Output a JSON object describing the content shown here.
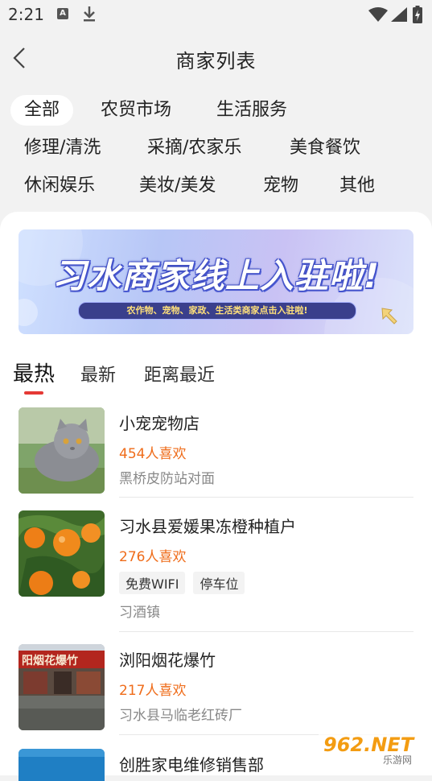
{
  "status_bar": {
    "time": "2:21",
    "a_badge": "A",
    "icons": [
      "download-icon",
      "wifi-icon",
      "signal-icon",
      "battery-icon"
    ]
  },
  "nav": {
    "title": "商家列表",
    "back_icon": "chevron-left-icon"
  },
  "categories": [
    {
      "label": "全部",
      "active": true
    },
    {
      "label": "农贸市场"
    },
    {
      "label": "生活服务"
    },
    {
      "label": "修理/清洗"
    },
    {
      "label": "采摘/农家乐"
    },
    {
      "label": "美食餐饮"
    },
    {
      "label": "休闲娱乐"
    },
    {
      "label": "美妆/美发"
    },
    {
      "label": "宠物"
    },
    {
      "label": "其他"
    }
  ],
  "banner": {
    "title": "习水商家线上入驻啦!",
    "subtitle": "农作物、宠物、家政、生活类商家点击入驻啦!"
  },
  "tabs": [
    {
      "label": "最热",
      "active": true
    },
    {
      "label": "最新"
    },
    {
      "label": "距离最近"
    }
  ],
  "stores": [
    {
      "name": "小宠宠物店",
      "likes": "454人喜欢",
      "tags": [],
      "address": "黑桥皮防站对面",
      "thumb": "cat-photo"
    },
    {
      "name": "习水县爱媛果冻橙种植户",
      "likes": "276人喜欢",
      "tags": [
        "免费WIFI",
        "停车位"
      ],
      "address": "习酒镇",
      "thumb": "orange-photo"
    },
    {
      "name": "浏阳烟花爆竹",
      "likes": "217人喜欢",
      "tags": [],
      "address": "习水县马临老红砖厂",
      "thumb": "shopfront-photo"
    },
    {
      "name": "创胜家电维修销售部",
      "likes": "",
      "tags": [],
      "address": "",
      "thumb": "blue-photo"
    }
  ],
  "watermark": {
    "text": "962.NET",
    "sub": "乐游网"
  },
  "colors": {
    "accent": "#e53935",
    "likes": "#ef6c1a",
    "background": "#f2f2f2"
  }
}
